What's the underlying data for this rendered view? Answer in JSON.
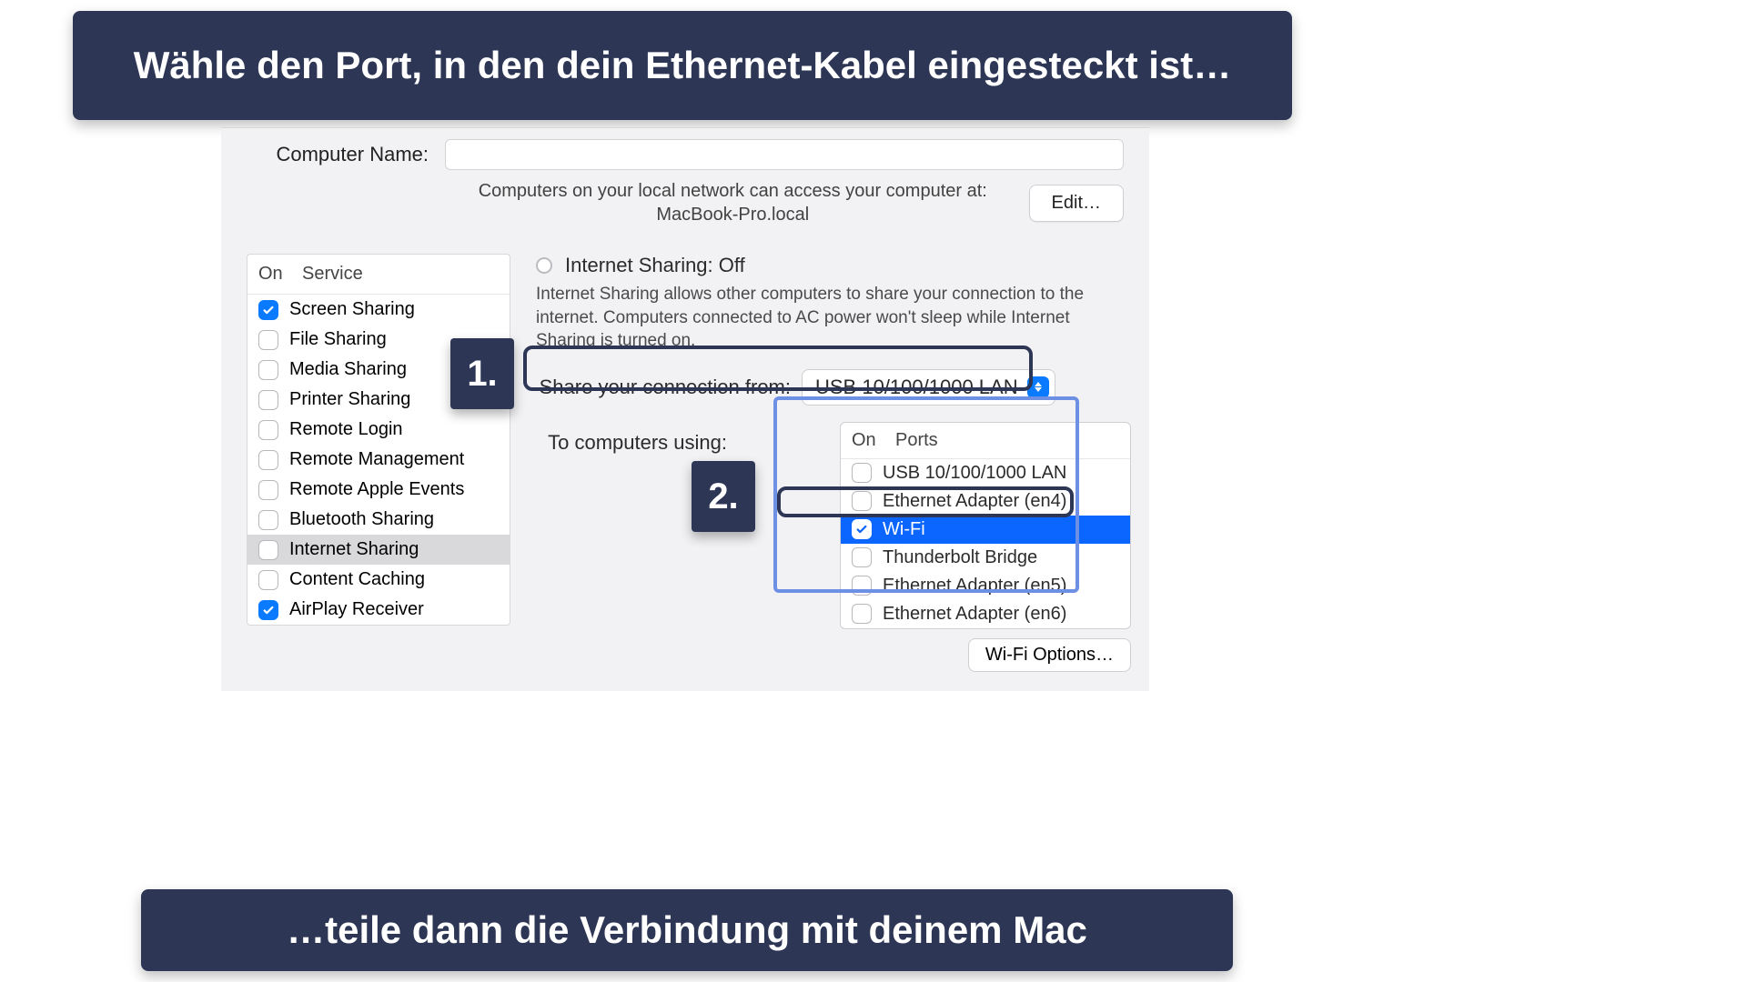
{
  "annotations": {
    "top_banner": "Wähle den Port, in den dein Ethernet-Kabel eingesteckt ist…",
    "bottom_banner": "…teile dann die Verbindung mit deinem Mac",
    "step1": "1.",
    "step2": "2."
  },
  "window": {
    "computer_name_label": "Computer Name:",
    "computer_name_value": "",
    "access_text": "Computers on your local network can access your computer at: MacBook-Pro.local",
    "edit_button": "Edit…",
    "service_header_on": "On",
    "service_header_service": "Service",
    "services": [
      {
        "on": true,
        "label": "Screen Sharing",
        "selected": false
      },
      {
        "on": false,
        "label": "File Sharing",
        "selected": false
      },
      {
        "on": false,
        "label": "Media Sharing",
        "selected": false
      },
      {
        "on": false,
        "label": "Printer Sharing",
        "selected": false
      },
      {
        "on": false,
        "label": "Remote Login",
        "selected": false
      },
      {
        "on": false,
        "label": "Remote Management",
        "selected": false
      },
      {
        "on": false,
        "label": "Remote Apple Events",
        "selected": false
      },
      {
        "on": false,
        "label": "Bluetooth Sharing",
        "selected": false
      },
      {
        "on": false,
        "label": "Internet Sharing",
        "selected": true
      },
      {
        "on": false,
        "label": "Content Caching",
        "selected": false
      },
      {
        "on": true,
        "label": "AirPlay Receiver",
        "selected": false
      }
    ],
    "detail": {
      "title": "Internet Sharing: Off",
      "description": "Internet Sharing allows other computers to share your connection to the internet. Computers connected to AC power won't sleep while Internet Sharing is turned on.",
      "share_from_label": "Share your connection from:",
      "share_from_value": "USB 10/100/1000 LAN",
      "to_label": "To computers using:",
      "ports_header_on": "On",
      "ports_header_ports": "Ports",
      "ports": [
        {
          "on": false,
          "label": "USB 10/100/1000 LAN",
          "selected": false
        },
        {
          "on": false,
          "label": "Ethernet Adapter (en4)",
          "selected": false
        },
        {
          "on": true,
          "label": "Wi-Fi",
          "selected": true
        },
        {
          "on": false,
          "label": "Thunderbolt Bridge",
          "selected": false
        },
        {
          "on": false,
          "label": "Ethernet Adapter (en5)",
          "selected": false
        },
        {
          "on": false,
          "label": "Ethernet Adapter (en6)",
          "selected": false
        }
      ],
      "wifi_options_button": "Wi-Fi Options…"
    }
  }
}
